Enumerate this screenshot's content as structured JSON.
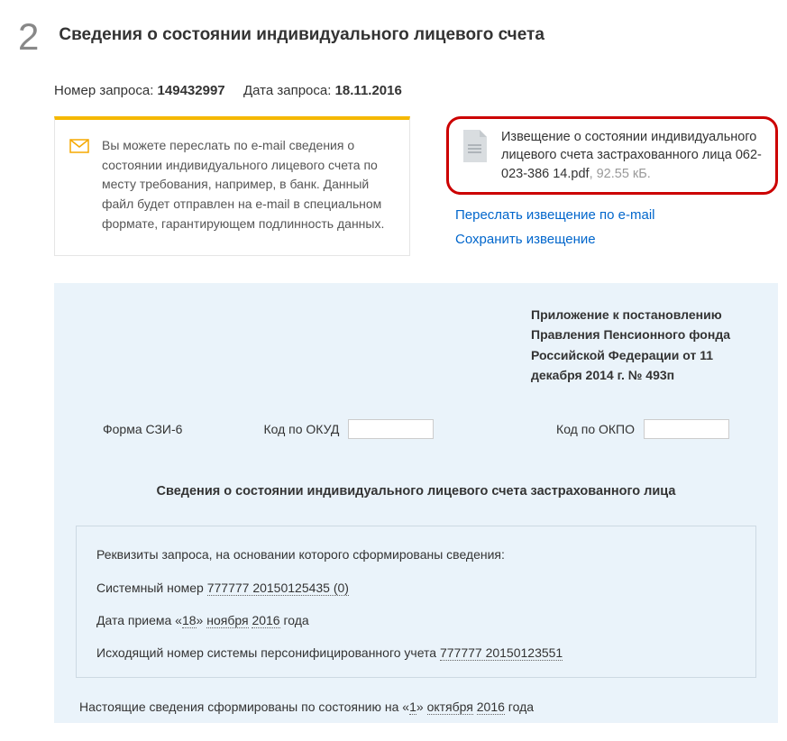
{
  "step_number": "2",
  "title": "Сведения о состоянии индивидуального лицевого счета",
  "meta": {
    "request_num_label": "Номер запроса: ",
    "request_num": "149432997",
    "request_date_label": "Дата запроса: ",
    "request_date": "18.11.2016"
  },
  "info_box": "Вы можете переслать по e-mail сведения о состоянии индивидуального лицевого счета по месту требования, например, в банк. Данный файл будет отправлен на e-mail в специальном формате, гарантирующем подлинность данных.",
  "file": {
    "desc": "Извещение о состоянии индивидуального лицевого счета застрахованного лица 062-023-386 14.pdf",
    "size": ", 92.55 кБ."
  },
  "links": {
    "forward": "Переслать извещение по e-mail",
    "save": "Сохранить извещение"
  },
  "appendix": "Приложение к постановлению Правления Пенсионного фонда Российской Федерации от 11 декабря 2014 г. № 493п",
  "form_row": {
    "form": "Форма СЗИ-6",
    "okud": "Код по ОКУД",
    "okpo": "Код по ОКПО"
  },
  "doc_title": "Сведения о состоянии индивидуального лицевого счета застрахованного лица",
  "req": {
    "heading": "Реквизиты запроса, на основании которого сформированы сведения:",
    "sys_label": "Системный номер ",
    "sys_num": "777777 20150125435 (0)",
    "date_label": "Дата приема «",
    "date_day": "18",
    "date_mid1": "»  ",
    "date_month": "ноября",
    "date_mid2": "  ",
    "date_year": "2016",
    "date_suffix": "  года",
    "out_label": "Исходящий номер системы персонифицированного учета ",
    "out_num": "777777 20150123551"
  },
  "status": {
    "prefix": "Настоящие сведения сформированы по состоянию на   «",
    "day": "1",
    "mid1": "»  ",
    "month": "октября",
    "mid2": "  ",
    "year": "2016",
    "suffix": "  года"
  }
}
